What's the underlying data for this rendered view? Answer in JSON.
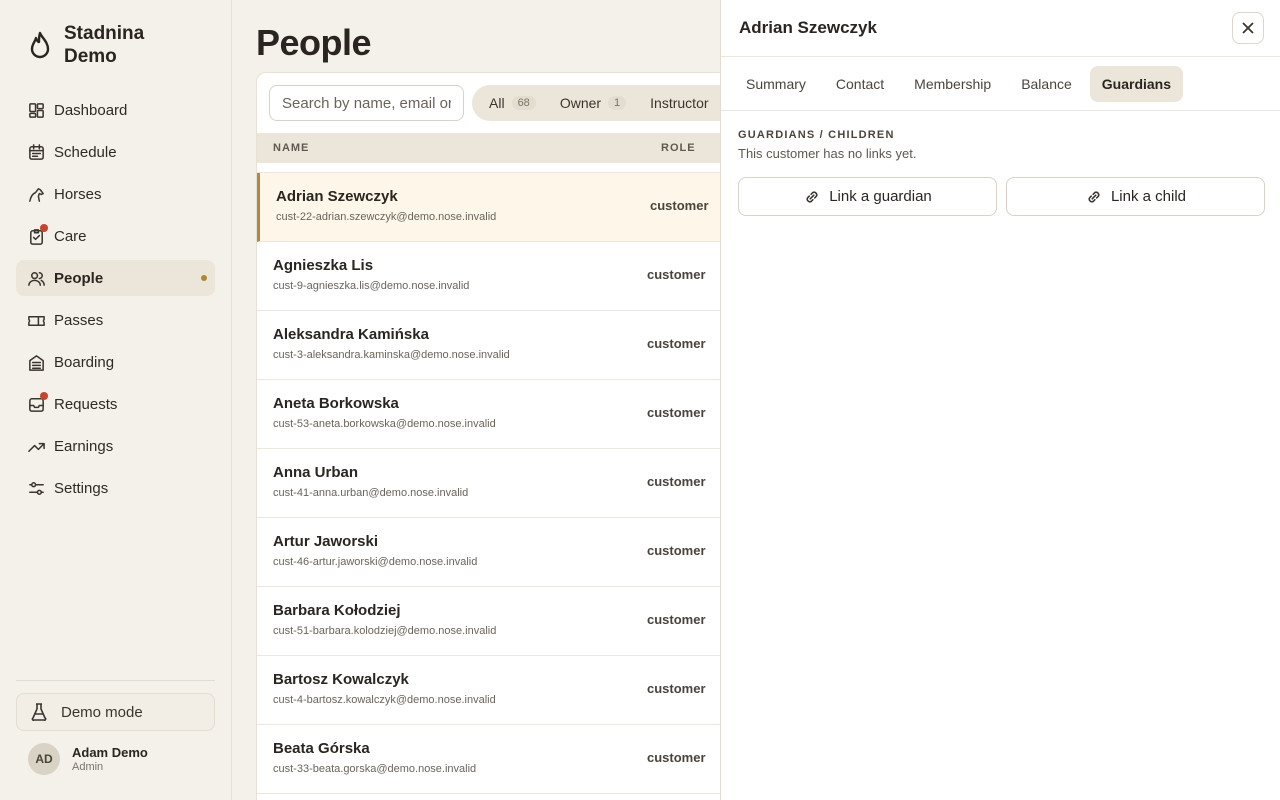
{
  "brand": {
    "name": "Stadnina Demo",
    "logo_icon": "flame-icon"
  },
  "sidebar": {
    "items": [
      {
        "label": "Dashboard",
        "icon": "grid-icon",
        "badge": false,
        "active": false
      },
      {
        "label": "Schedule",
        "icon": "calendar-icon",
        "badge": false,
        "active": false
      },
      {
        "label": "Horses",
        "icon": "horse-icon",
        "badge": false,
        "active": false
      },
      {
        "label": "Care",
        "icon": "clipboard-icon",
        "badge": true,
        "active": false
      },
      {
        "label": "People",
        "icon": "people-icon",
        "badge": false,
        "active": true
      },
      {
        "label": "Passes",
        "icon": "ticket-icon",
        "badge": false,
        "active": false
      },
      {
        "label": "Boarding",
        "icon": "building-icon",
        "badge": false,
        "active": false
      },
      {
        "label": "Requests",
        "icon": "inbox-icon",
        "badge": true,
        "active": false
      },
      {
        "label": "Earnings",
        "icon": "trend-icon",
        "badge": false,
        "active": false
      },
      {
        "label": "Settings",
        "icon": "sliders-icon",
        "badge": false,
        "active": false
      }
    ],
    "demo_mode_label": "Demo mode",
    "user": {
      "initials": "AD",
      "name": "Adam Demo",
      "role": "Admin"
    }
  },
  "main": {
    "title": "People",
    "search": {
      "placeholder": "Search by name, email or phone",
      "value": ""
    },
    "filters": [
      {
        "label": "All",
        "count": "68"
      },
      {
        "label": "Owner",
        "count": "1"
      },
      {
        "label": "Instructor",
        "count": ""
      }
    ],
    "columns": {
      "name": "NAME",
      "role": "ROLE"
    },
    "rows": [
      {
        "name": "Adrian Szewczyk",
        "email": "cust-22-adrian.szewczyk@demo.nose.invalid",
        "role": "customer"
      },
      {
        "name": "Agnieszka Lis",
        "email": "cust-9-agnieszka.lis@demo.nose.invalid",
        "role": "customer"
      },
      {
        "name": "Aleksandra Kamińska",
        "email": "cust-3-aleksandra.kaminska@demo.nose.invalid",
        "role": "customer"
      },
      {
        "name": "Aneta Borkowska",
        "email": "cust-53-aneta.borkowska@demo.nose.invalid",
        "role": "customer"
      },
      {
        "name": "Anna Urban",
        "email": "cust-41-anna.urban@demo.nose.invalid",
        "role": "customer"
      },
      {
        "name": "Artur Jaworski",
        "email": "cust-46-artur.jaworski@demo.nose.invalid",
        "role": "customer"
      },
      {
        "name": "Barbara Kołodziej",
        "email": "cust-51-barbara.kolodziej@demo.nose.invalid",
        "role": "customer"
      },
      {
        "name": "Bartosz Kowalczyk",
        "email": "cust-4-bartosz.kowalczyk@demo.nose.invalid",
        "role": "customer"
      },
      {
        "name": "Beata Górska",
        "email": "cust-33-beata.gorska@demo.nose.invalid",
        "role": "customer"
      }
    ]
  },
  "drawer": {
    "title": "Adrian Szewczyk",
    "tabs": [
      "Summary",
      "Contact",
      "Membership",
      "Balance",
      "Guardians"
    ],
    "active_tab": "Guardians",
    "section_label": "GUARDIANS / CHILDREN",
    "section_note": "This customer has no links yet.",
    "link_guardian_label": "Link a guardian",
    "link_child_label": "Link a child"
  },
  "colors": {
    "accent": "#b5893a",
    "badge": "#c4452d",
    "background": "#f4f1ea"
  }
}
